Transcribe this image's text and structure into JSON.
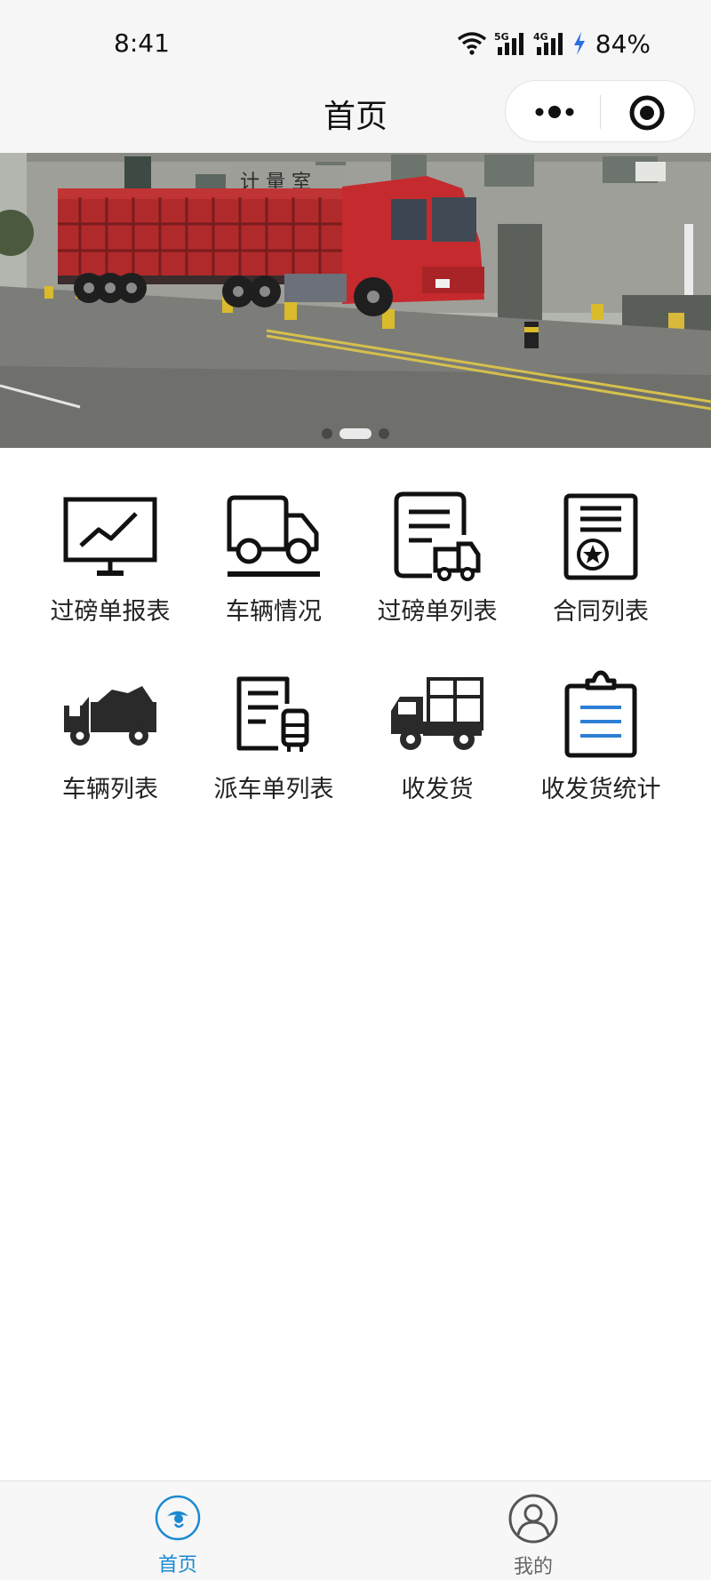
{
  "status_bar": {
    "time": "8:41",
    "battery": "84%",
    "icons": [
      "wifi-icon",
      "signal-5g-icon",
      "signal-4g-icon",
      "charging-icon"
    ]
  },
  "nav": {
    "title": "首页",
    "capsule_icons": [
      "more-icon",
      "close-mini-program-icon"
    ]
  },
  "banner": {
    "image": "red-truck-on-weighbridge",
    "slide_count": 3,
    "active_slide": 2
  },
  "menu": {
    "items": [
      {
        "label": "过磅单报表",
        "icon": "report-chart-icon"
      },
      {
        "label": "车辆情况",
        "icon": "truck-icon"
      },
      {
        "label": "过磅单列表",
        "icon": "document-truck-icon"
      },
      {
        "label": "合同列表",
        "icon": "contract-icon"
      },
      {
        "label": "车辆列表",
        "icon": "loaded-truck-icon"
      },
      {
        "label": "派车单列表",
        "icon": "dispatch-document-icon"
      },
      {
        "label": "收发货",
        "icon": "delivery-truck-icon"
      },
      {
        "label": "收发货统计",
        "icon": "clipboard-icon"
      }
    ]
  },
  "tab_bar": {
    "tabs": [
      {
        "label": "首页",
        "icon": "home-eye-icon",
        "active": true
      },
      {
        "label": "我的",
        "icon": "profile-icon",
        "active": false
      }
    ],
    "accent_color": "#1a8ad1"
  }
}
